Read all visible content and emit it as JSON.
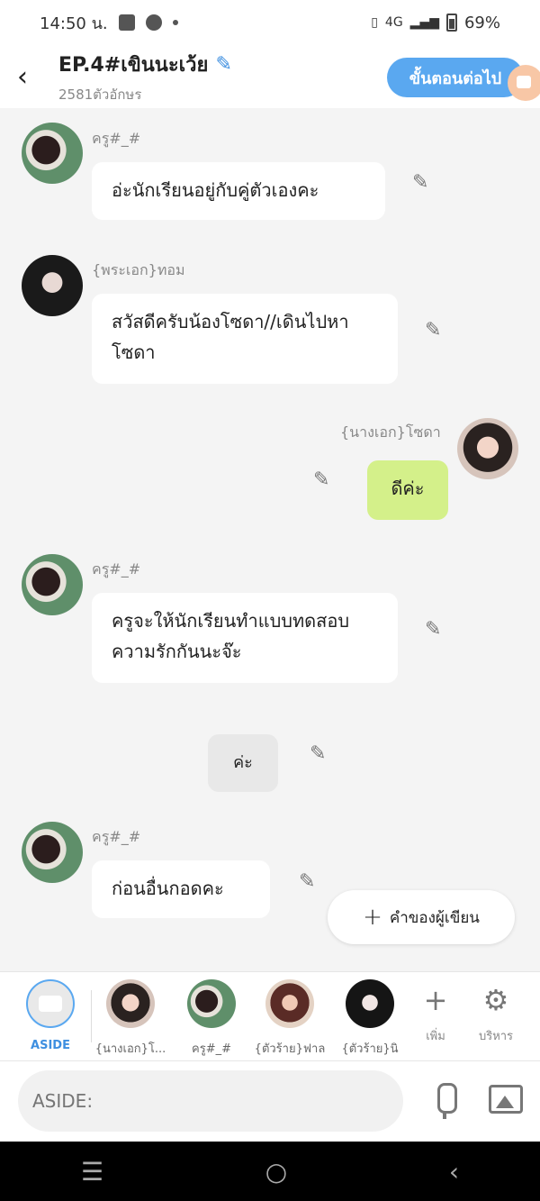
{
  "status_bar": {
    "time": "14:50 น.",
    "network": "4G",
    "battery": "69%"
  },
  "header": {
    "title": "EP.4#เขินนะเว้ย",
    "subtitle": "2581ตัวอักษร",
    "next_label": "ขั้นตอนต่อไป"
  },
  "messages": [
    {
      "name": "ครู#_#",
      "text": "อ่ะนักเรียนอยู่กับคู่ตัวเองคะ"
    },
    {
      "name": "{พระเอก}ทอม",
      "text": "สวัสดีครับน้องโซดา//เดินไปหาโซดา"
    },
    {
      "name": "{นางเอก}โซดา",
      "text": "ดีค่ะ"
    },
    {
      "name": "ครู#_#",
      "text": "ครูจะให้นักเรียนทำแบบทดสอบความรักกันนะจ๊ะ"
    },
    {
      "text": "ค่ะ"
    },
    {
      "name": "ครู#_#",
      "text": "ก่อนอื่นกอดคะ"
    }
  ],
  "author_button": "คำของผู้เขียน",
  "characters": [
    {
      "label": "ASIDE"
    },
    {
      "label": "{นางเอก}โ..."
    },
    {
      "label": "ครู#_#"
    },
    {
      "label": "{ตัวร้าย}ฟาล"
    },
    {
      "label": "{ตัวร้าย}นิ"
    }
  ],
  "tools": {
    "add_label": "เพิ่ม",
    "manage_label": "บริหาร"
  },
  "input": {
    "placeholder": "ASIDE:"
  }
}
